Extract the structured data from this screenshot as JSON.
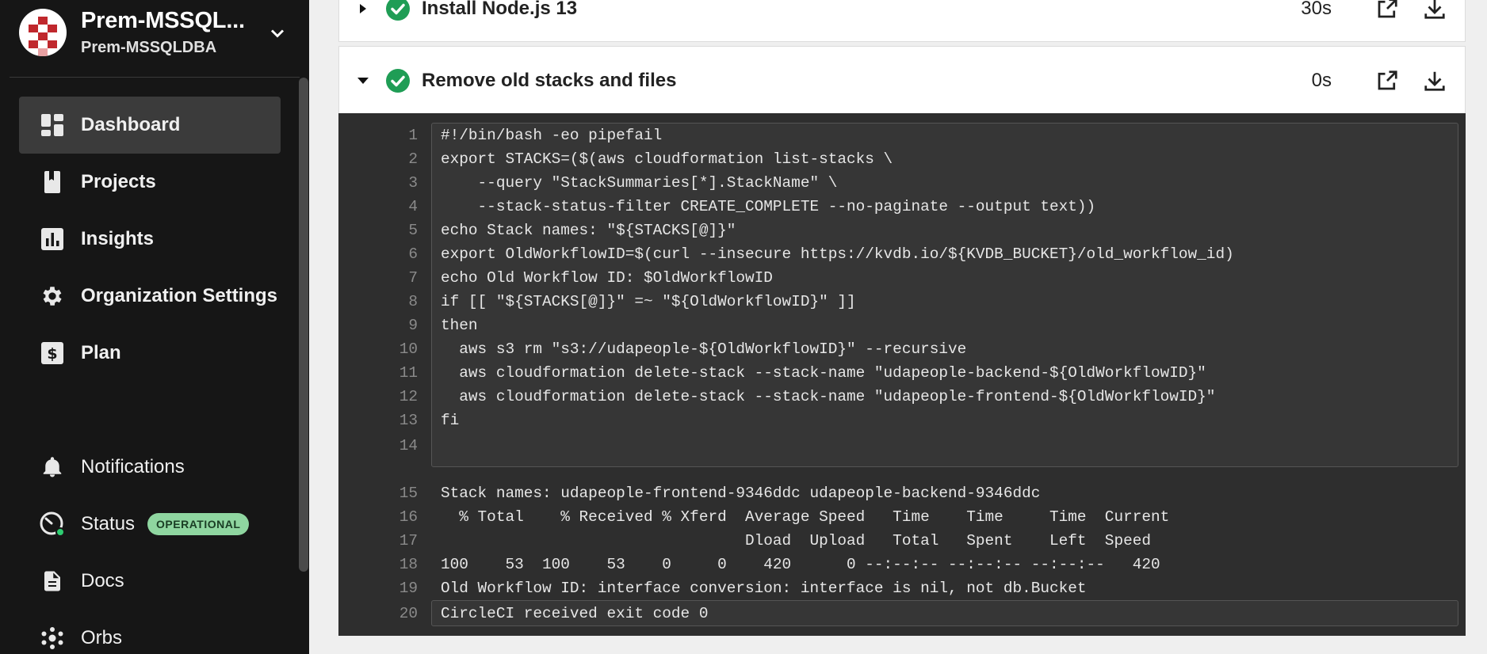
{
  "sidebar": {
    "org_name": "Prem-MSSQL...",
    "org_sub": "Prem-MSSQLDBA",
    "nav": [
      {
        "label": "Dashboard",
        "icon": "dashboard-icon"
      },
      {
        "label": "Projects",
        "icon": "book-icon"
      },
      {
        "label": "Insights",
        "icon": "bar-chart-icon"
      },
      {
        "label": "Organization Settings",
        "icon": "gear-icon"
      },
      {
        "label": "Plan",
        "icon": "dollar-icon"
      },
      {
        "label": "Notifications",
        "icon": "bell-icon"
      },
      {
        "label": "Status",
        "icon": "gauge-icon",
        "badge": "OPERATIONAL"
      },
      {
        "label": "Docs",
        "icon": "document-icon"
      },
      {
        "label": "Orbs",
        "icon": "orbs-icon"
      }
    ]
  },
  "steps": [
    {
      "title": "Install Node.js 13",
      "duration": "30s",
      "expanded": false
    },
    {
      "title": "Remove old stacks and files",
      "duration": "0s",
      "expanded": true
    }
  ],
  "log": [
    {
      "n": "1",
      "text": "#!/bin/bash -eo pipefail"
    },
    {
      "n": "2",
      "text": "export STACKS=($(aws cloudformation list-stacks \\"
    },
    {
      "n": "3",
      "text": "    --query \"StackSummaries[*].StackName\" \\"
    },
    {
      "n": "4",
      "text": "    --stack-status-filter CREATE_COMPLETE --no-paginate --output text))"
    },
    {
      "n": "5",
      "text": "echo Stack names: \"${STACKS[@]}\""
    },
    {
      "n": "6",
      "text": "export OldWorkflowID=$(curl --insecure https://kvdb.io/${KVDB_BUCKET}/old_workflow_id)"
    },
    {
      "n": "7",
      "text": "echo Old Workflow ID: $OldWorkflowID"
    },
    {
      "n": "8",
      "text": "if [[ \"${STACKS[@]}\" =~ \"${OldWorkflowID}\" ]]"
    },
    {
      "n": "9",
      "text": "then"
    },
    {
      "n": "10",
      "text": "  aws s3 rm \"s3://udapeople-${OldWorkflowID}\" --recursive"
    },
    {
      "n": "11",
      "text": "  aws cloudformation delete-stack --stack-name \"udapeople-backend-${OldWorkflowID}\""
    },
    {
      "n": "12",
      "text": "  aws cloudformation delete-stack --stack-name \"udapeople-frontend-${OldWorkflowID}\""
    },
    {
      "n": "13",
      "text": "fi"
    },
    {
      "n": "14",
      "text": ""
    },
    {
      "n": "15",
      "text": "Stack names: udapeople-frontend-9346ddc udapeople-backend-9346ddc"
    },
    {
      "n": "16",
      "text": "  % Total    % Received % Xferd  Average Speed   Time    Time     Time  Current"
    },
    {
      "n": "17",
      "text": "                                 Dload  Upload   Total   Spent    Left  Speed"
    },
    {
      "n": "18",
      "text": "100    53  100    53    0     0    420      0 --:--:-- --:--:-- --:--:--   420"
    },
    {
      "n": "19",
      "text": "Old Workflow ID: interface conversion: interface is nil, not db.Bucket"
    },
    {
      "n": "20",
      "text": "CircleCI received exit code 0"
    }
  ],
  "colors": {
    "success": "#1f9d55",
    "sidebar_bg": "#161616",
    "terminal_bg": "#2e2e2e"
  }
}
